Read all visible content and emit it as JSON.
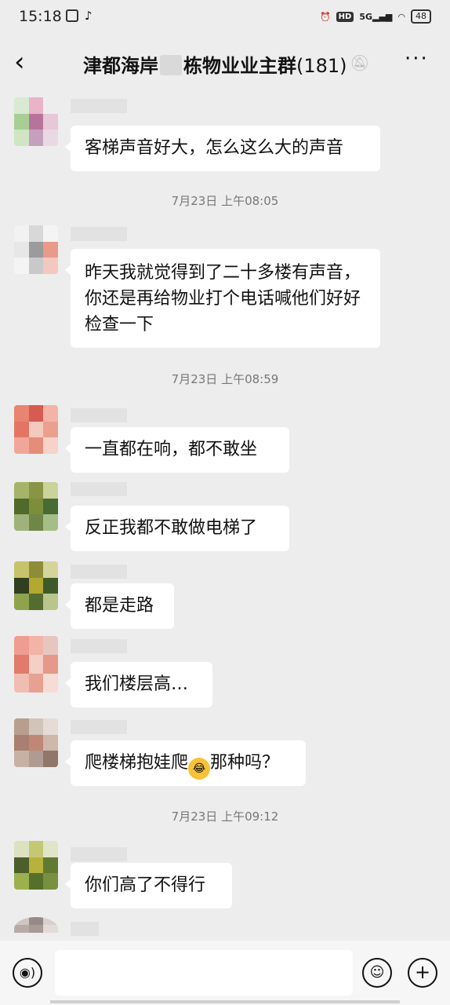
{
  "status_bar": {
    "time": "15:18",
    "network": "5G",
    "hd": "HD",
    "battery": "48"
  },
  "header": {
    "title_left": "津都海岸",
    "title_right": "栋物业业主群",
    "member_count": "(181)",
    "back_icon": "chevron-left-icon",
    "mute_icon": "bell-off-icon",
    "more_icon": "more-icon"
  },
  "messages": [
    {
      "type": "text",
      "text": "客梯声音好大，怎么这么大的声音"
    },
    {
      "type": "time",
      "text": "7月23日 上午08:05"
    },
    {
      "type": "text",
      "text": "昨天我就觉得到了二十多楼有声音，你还是再给物业打个电话喊他们好好检查一下"
    },
    {
      "type": "time",
      "text": "7月23日 上午08:59"
    },
    {
      "type": "text",
      "text": "一直都在响，都不敢坐"
    },
    {
      "type": "text",
      "text": "反正我都不敢做电梯了"
    },
    {
      "type": "text",
      "text": "都是走路"
    },
    {
      "type": "text",
      "text": "我们楼层高…"
    },
    {
      "type": "text",
      "text_before": "爬楼梯抱娃爬",
      "emoji": "crying-laughing-emoji",
      "text_after": "那种吗？"
    },
    {
      "type": "time",
      "text": "7月23日 上午09:12"
    },
    {
      "type": "text",
      "text": "你们高了不得行"
    }
  ],
  "input_bar": {
    "voice_icon": "voice-icon",
    "emoji_icon": "emoji-icon",
    "plus_icon": "plus-icon",
    "placeholder": ""
  }
}
